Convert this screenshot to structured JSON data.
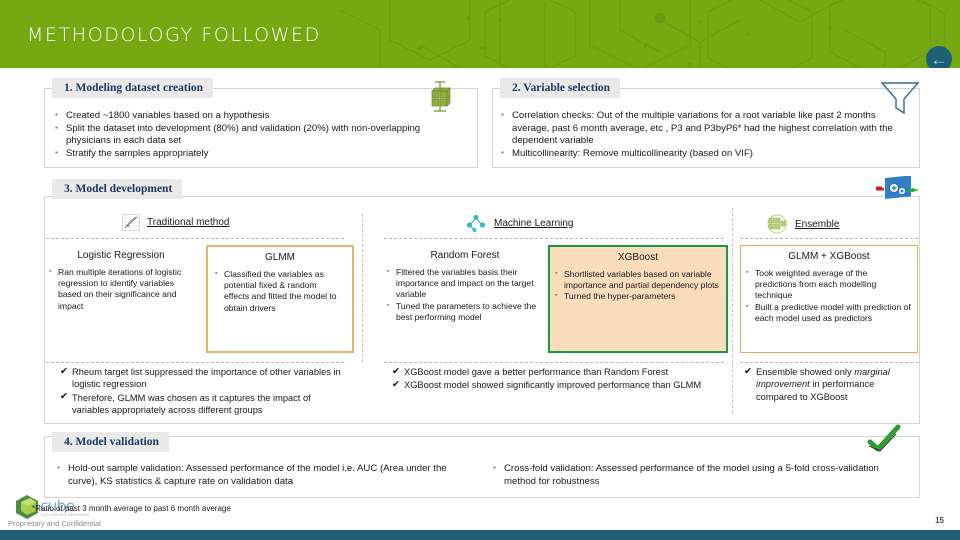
{
  "header": {
    "title": "METHODOLOGY FOLLOWED",
    "back_icon": "arrow-left-circle-icon",
    "banner_color": "#76a812",
    "back_button_color": "#1e6076"
  },
  "sections": {
    "s1": {
      "title": "1. Modeling dataset creation",
      "icon": "cube-database-icon",
      "bullets": [
        "Created ~1800 variables based on a hypothesis",
        "Split the dataset into development (80%) and validation (20%) with non-overlapping physicians in each data set",
        "Stratify the samples appropriately"
      ]
    },
    "s2": {
      "title": "2. Variable selection",
      "icon": "funnel-filter-icon",
      "bullets": [
        "Correlation checks: Out of the multiple variations for a root variable like past 2 months average, past 6 month average, etc , P3 and P3byP6* had the highest correlation with the dependent variable",
        "Multicollinearity: Remove multicollinearity (based on VIF)"
      ]
    },
    "s3": {
      "title": "3. Model development",
      "icon": "gears-process-icon",
      "groups": [
        {
          "label": "Traditional method",
          "icon": "scatter-plot-icon"
        },
        {
          "label": "Machine Learning",
          "icon": "decision-tree-icon"
        },
        {
          "label": "Ensemble",
          "icon": "ensemble-blocks-icon"
        }
      ],
      "models": [
        {
          "name": "Logistic Regression",
          "highlight": "none",
          "bullets": [
            "Ran multiple iterations of logistic regression to identify variables based on their significance and impact"
          ]
        },
        {
          "name": "GLMM",
          "highlight": "orange",
          "bullets": [
            "Classified the variables as potential fixed & random effects and fitted the model to obtain drivers"
          ]
        },
        {
          "name": "Random Forest",
          "highlight": "none",
          "bullets": [
            "Filtered the variables basis their importance and impact on the target variable",
            "Tuned the parameters to achieve the best performing model"
          ]
        },
        {
          "name": "XGBoost",
          "highlight": "green",
          "bullets": [
            "Shortlisted variables based on variable importance and partial dependency plots",
            "Turned the hyper-parameters"
          ]
        },
        {
          "name": "GLMM + XGBoost",
          "highlight": "orange2",
          "bullets": [
            "Took weighted average of the predictions from each modelling technique",
            "Built a predictive model with prediction of each model used as predictors"
          ]
        }
      ],
      "conclusions": {
        "traditional": [
          "Rheum target list suppressed the importance of other variables in logistic regression",
          "Therefore, GLMM was chosen as it captures the impact of variables appropriately across different groups"
        ],
        "ml": [
          "XGBoost model gave a better performance than Random Forest",
          "XGBoost model showed significantly improved performance than GLMM"
        ],
        "ensemble_pre": "Ensemble showed only ",
        "ensemble_italic": "marginal improvement",
        "ensemble_post": " in performance compared to XGBoost"
      }
    },
    "s4": {
      "title": "4. Model validation",
      "icon": "green-check-icon",
      "left_bullets": [
        "Hold-out sample validation: Assessed performance of the model i.e. AUC (Area under the curve), KS statistics & capture rate on validation data"
      ],
      "right_bullets": [
        "Cross-fold validation: Assessed performance of the model using a 5-fold cross-validation method for robustness"
      ]
    }
  },
  "footer": {
    "footnote": "*Ratio of past 3 month average to past 6 month average",
    "proprietary": "Proprietary and Confidential",
    "page_number": "15",
    "logo_text": "cube",
    "logo_tagline": "DATA DRIVEN DECISIONS"
  }
}
